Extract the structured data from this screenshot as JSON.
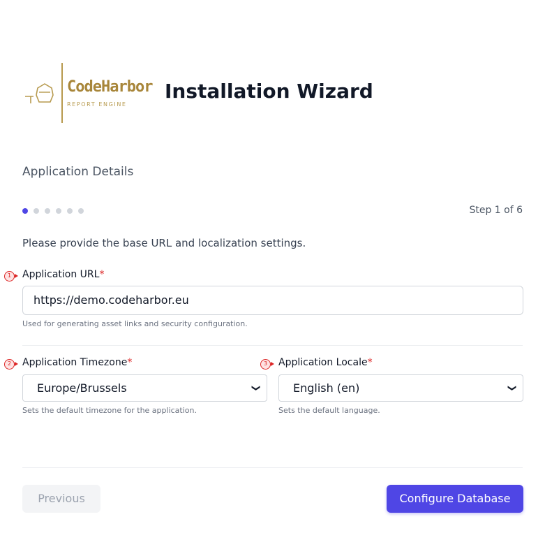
{
  "brand": {
    "name": "CodeHarbor",
    "tagline": "REPORT ENGINE",
    "color": "#a8863a"
  },
  "header": {
    "title": "Installation Wizard"
  },
  "section": {
    "heading": "Application Details"
  },
  "progress": {
    "current_step": 1,
    "total_steps": 6,
    "counter_text": "Step 1 of 6",
    "accent": "#4f46e5"
  },
  "intro": "Please provide the base URL and localization settings.",
  "fields": {
    "url": {
      "marker": "1",
      "label": "Application URL",
      "required_mark": "*",
      "value": "https://demo.codeharbor.eu",
      "help": "Used for generating asset links and security configuration."
    },
    "timezone": {
      "marker": "2",
      "label": "Application Timezone",
      "required_mark": "*",
      "value": "Europe/Brussels",
      "help": "Sets the default timezone for the application."
    },
    "locale": {
      "marker": "3",
      "label": "Application Locale",
      "required_mark": "*",
      "value": "English (en)",
      "help": "Sets the default language."
    }
  },
  "actions": {
    "previous_label": "Previous",
    "next_label": "Configure Database"
  }
}
